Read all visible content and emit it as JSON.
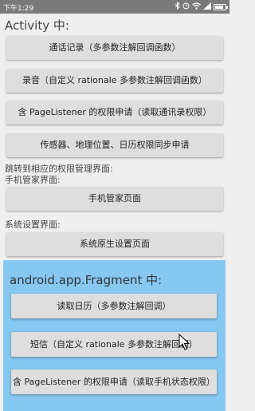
{
  "statusbar": {
    "time": "下午1:29",
    "icons": [
      "bluetooth-icon",
      "alarm-icon",
      "wifi-icon",
      "signal-icon",
      "battery-icon"
    ]
  },
  "activity": {
    "title": "Activity 中:",
    "buttons": [
      "通话记录（多参数注解回调函数）",
      "录音（自定义 rationale 多参数注解回调函数）",
      "含 PageListener 的权限申请（读取通讯录权限）",
      "传感器、地理位置、日历权限同步申请"
    ],
    "jump_label": "跳转到相应的权限管理界面:",
    "phone_manager_label": "手机管家界面:",
    "phone_manager_button": "手机管家页面",
    "system_settings_label": "系统设置界面:",
    "system_settings_button": "系统原生设置页面"
  },
  "fragment": {
    "title": "android.app.Fragment 中:",
    "buttons": [
      "读取日历（多参数注解回调）",
      "短信（自定义 rationale 多参数注解回调）",
      "含 PageListener 的权限申请（读取手机状态权限）"
    ],
    "background": "#87c8f2"
  }
}
